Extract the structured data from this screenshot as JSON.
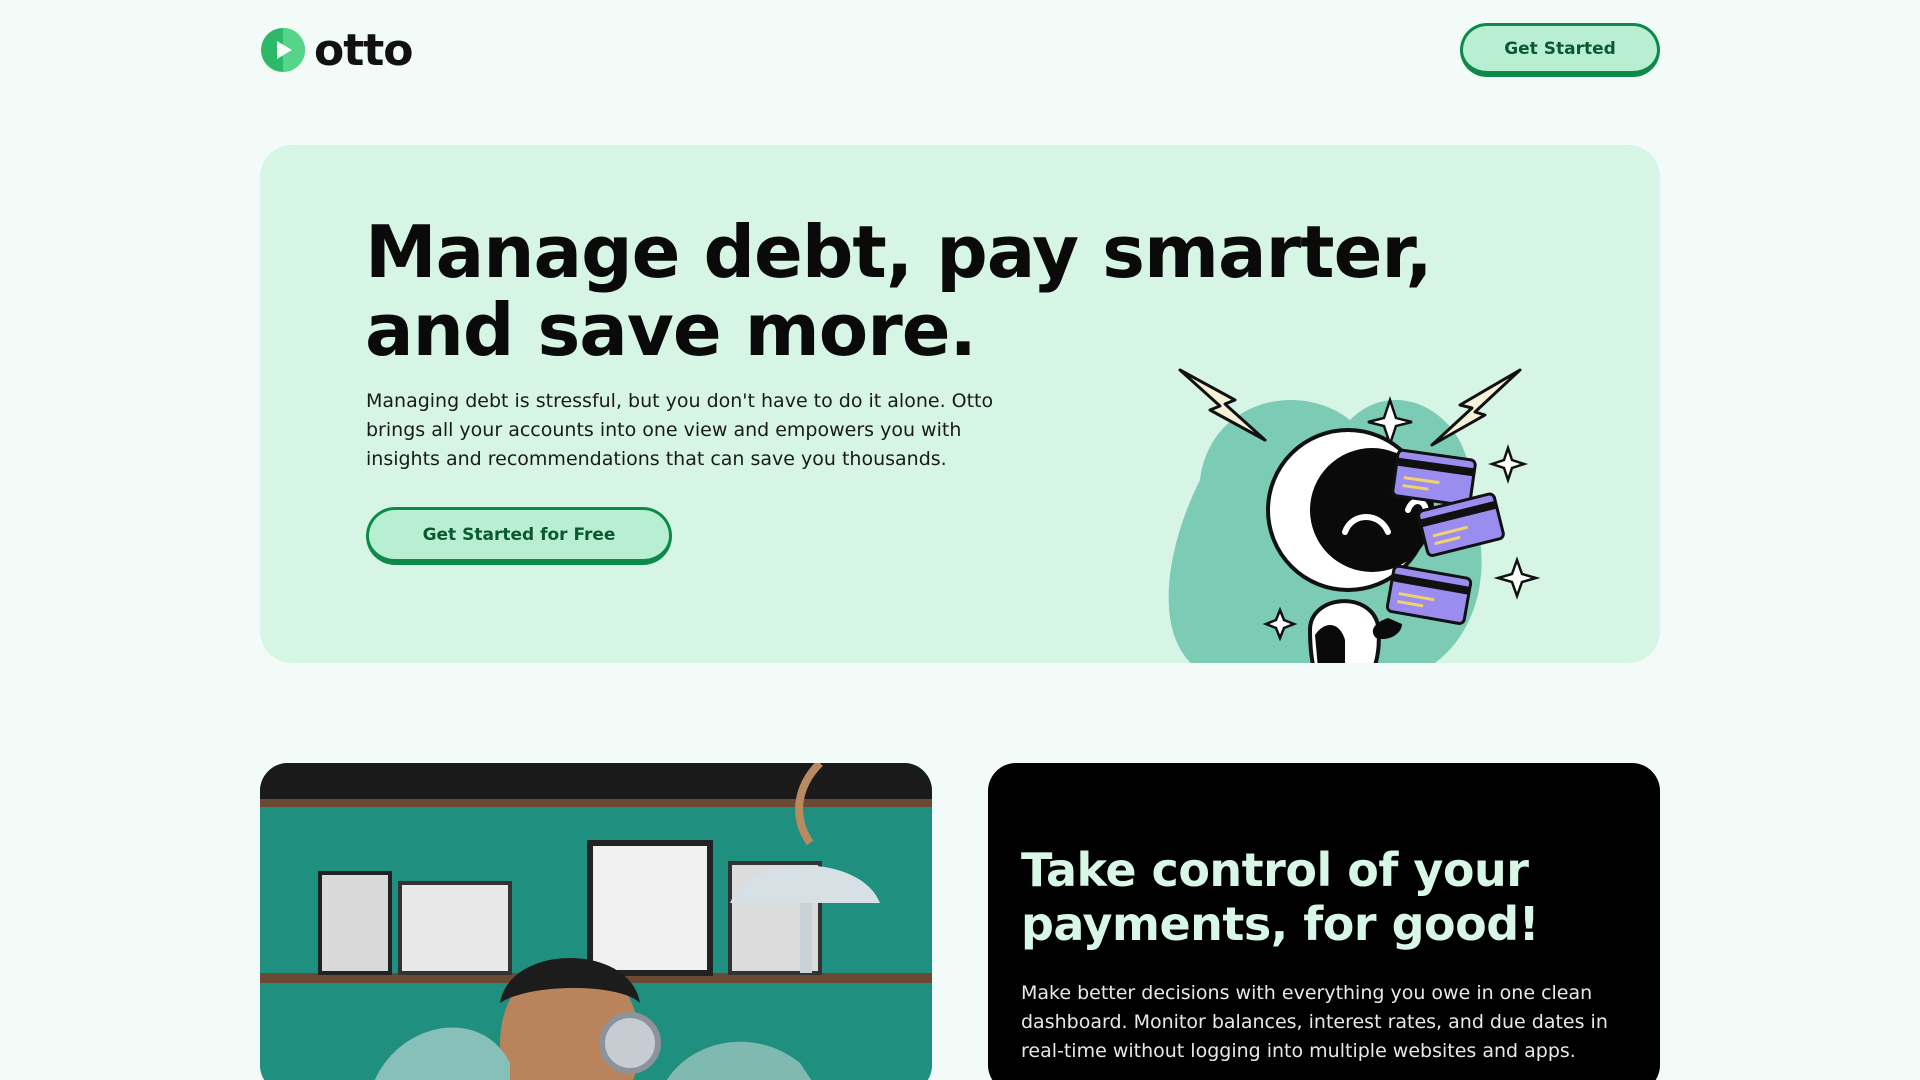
{
  "header": {
    "logo_text": "otto",
    "cta_label": "Get Started"
  },
  "hero": {
    "title": "Manage debt, pay smarter, and save more.",
    "subtitle": "Managing debt is stressful, but you don't have to do it alone. Otto brings all your accounts into one view and empowers you with insights and recommendations that can save you thousands.",
    "cta_label": "Get Started for Free"
  },
  "feature": {
    "title": "Take control of your payments, for good!",
    "body": "Make better decisions with everything you owe in one clean dashboard. Monitor balances, interest rates, and due dates in real-time without logging into multiple websites and apps."
  },
  "colors": {
    "page_bg": "#f2fbf7",
    "hero_bg": "#d6f5e4",
    "accent_green": "#0d8a4a",
    "button_fill": "#b8efd2",
    "dark_card": "#000000",
    "card_purple": "#9b8cf0"
  },
  "icons": {
    "logo": "otto-logo-icon",
    "illustration": "robot-with-credit-cards-illustration"
  }
}
